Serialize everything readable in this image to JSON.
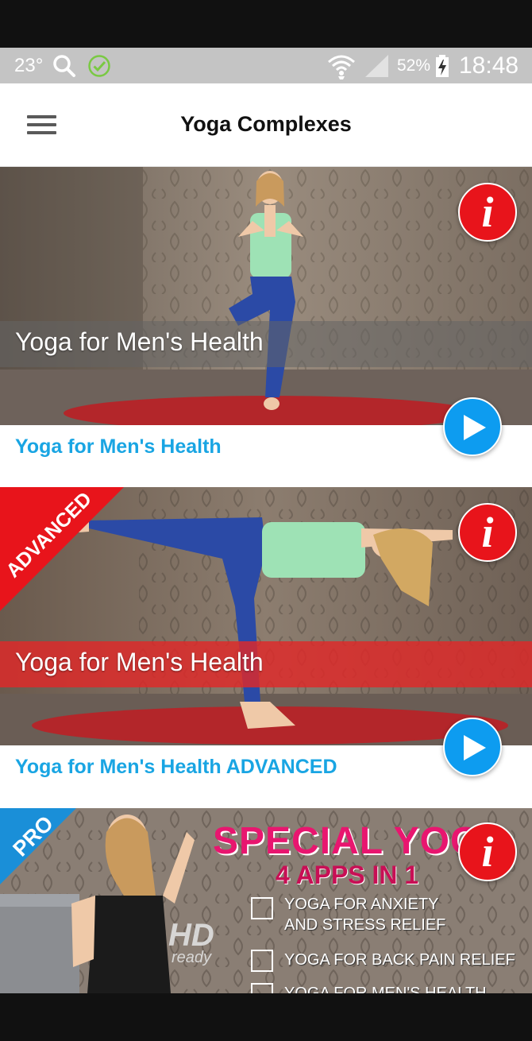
{
  "status_bar": {
    "temperature": "23°",
    "battery_percent": "52%",
    "time": "18:48"
  },
  "app_bar": {
    "title": "Yoga Complexes",
    "menu_icon": "hamburger-menu-icon"
  },
  "cards": [
    {
      "image_caption": "Yoga for Men's Health",
      "title": "Yoga for Men's Health",
      "ribbon": "",
      "info_symbol": "i"
    },
    {
      "image_caption": "Yoga for Men's Health",
      "title": "Yoga for Men's Health ADVANCED",
      "ribbon": "ADVANCED",
      "info_symbol": "i"
    },
    {
      "ribbon": "PRO",
      "info_symbol": "i",
      "headline": "SPECIAL YOGA",
      "subheadline": "4 APPS IN 1",
      "hd_badge": "HD",
      "hd_ready": "ready",
      "items": [
        "YOGA FOR ANXIETY",
        "AND STRESS RELIEF",
        "YOGA FOR BACK PAIN RELIEF",
        "YOGA FOR MEN'S HEALTH"
      ]
    }
  ],
  "colors": {
    "accent_blue": "#19a5e3",
    "info_red": "#e8141b",
    "play_blue": "#0d9cf0",
    "ribbon_red": "#e8141b",
    "ribbon_blue": "#1a8fd8"
  }
}
